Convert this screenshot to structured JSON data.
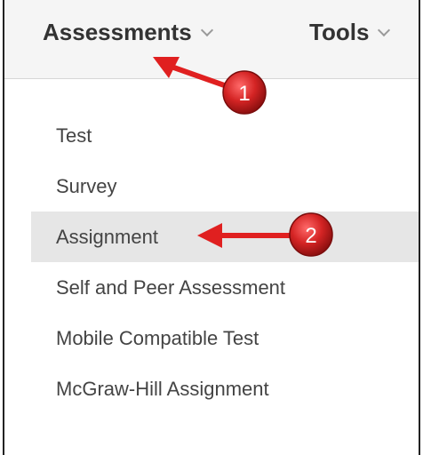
{
  "menu": {
    "tabs": [
      {
        "label": "Assessments",
        "icon": "chevron-down-icon"
      },
      {
        "label": "Tools",
        "icon": "chevron-down-icon"
      }
    ]
  },
  "dropdown": {
    "items": [
      {
        "label": "Test"
      },
      {
        "label": "Survey"
      },
      {
        "label": "Assignment",
        "highlighted": true
      },
      {
        "label": "Self and Peer Assessment"
      },
      {
        "label": "Mobile Compatible Test"
      },
      {
        "label": "McGraw-Hill Assignment"
      }
    ]
  },
  "annotations": {
    "step1": "1",
    "step2": "2",
    "marker_color": "#cc1f1f",
    "arrow_color": "#e02020"
  }
}
